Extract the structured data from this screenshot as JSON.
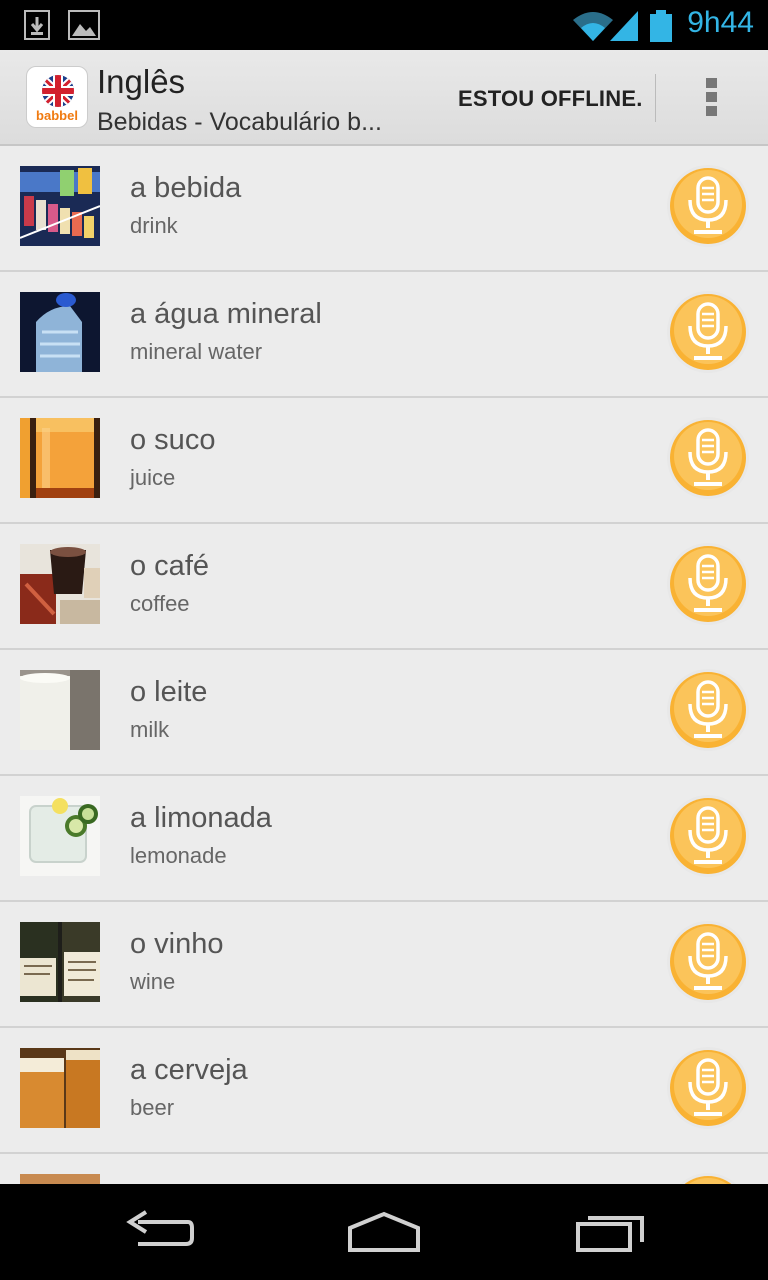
{
  "status_bar": {
    "time": "9h44",
    "icons": [
      "download-icon",
      "image-icon",
      "wifi-icon",
      "signal-icon",
      "battery-icon"
    ],
    "accent_color": "#33b5e5"
  },
  "action_bar": {
    "app_logo_text": "babbel",
    "title": "Inglês",
    "subtitle": "Bebidas - Vocabulário b...",
    "offline_label": "ESTOU OFFLINE.",
    "overflow_icon": "overflow-menu-icon"
  },
  "vocabulary": [
    {
      "word": "a bebida",
      "translation": "drink"
    },
    {
      "word": "a água mineral",
      "translation": "mineral water"
    },
    {
      "word": "o suco",
      "translation": "juice"
    },
    {
      "word": "o café",
      "translation": "coffee"
    },
    {
      "word": "o leite",
      "translation": "milk"
    },
    {
      "word": "a limonada",
      "translation": "lemonade"
    },
    {
      "word": "o vinho",
      "translation": "wine"
    },
    {
      "word": "a cerveja",
      "translation": "beer"
    }
  ],
  "mic_color": "#f9b233",
  "nav_bar": {
    "icons": [
      "back-icon",
      "home-icon",
      "recent-apps-icon"
    ]
  }
}
